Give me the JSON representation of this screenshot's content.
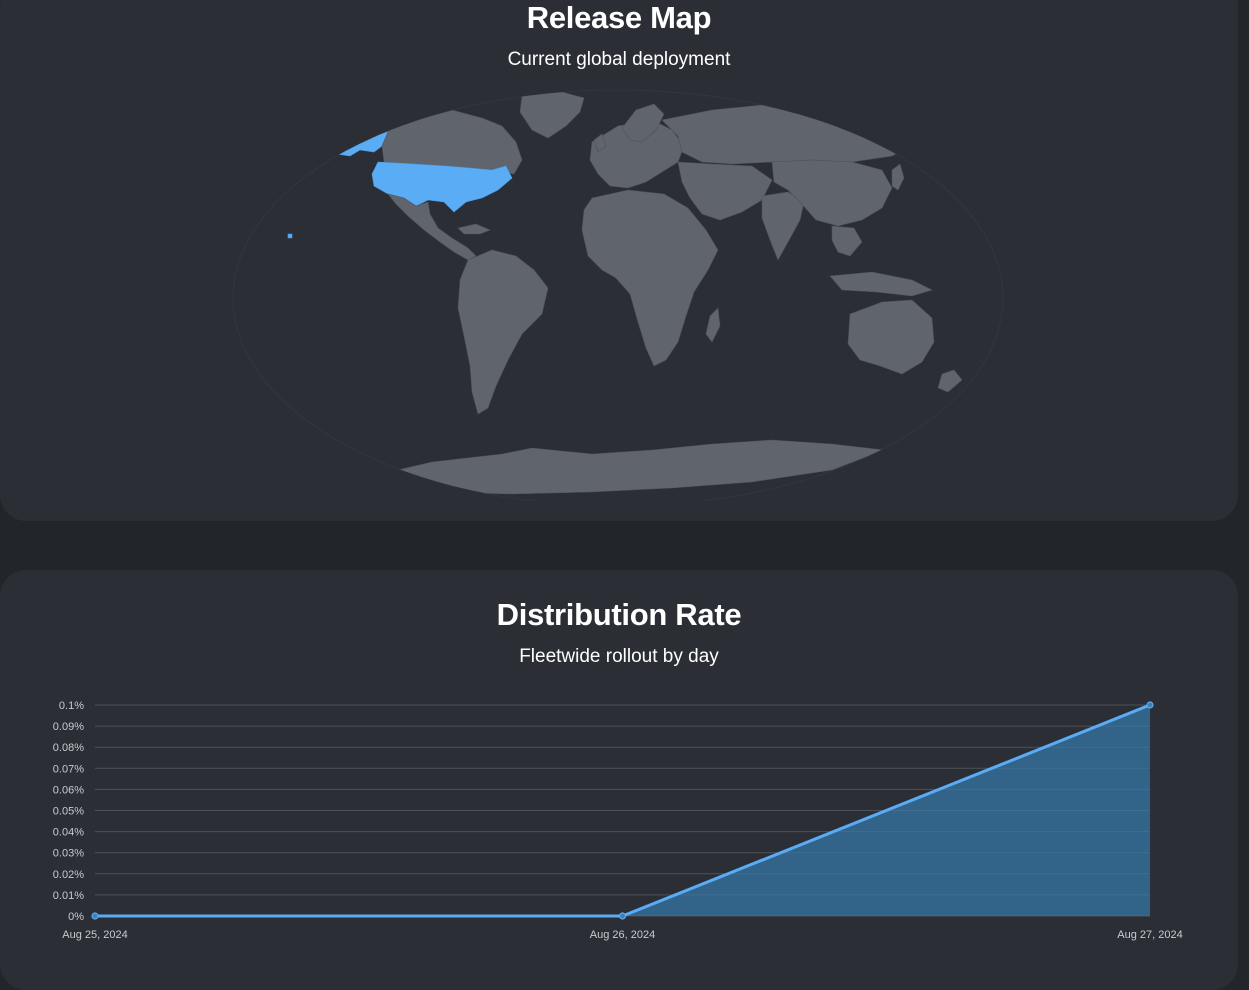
{
  "release_map": {
    "title": "Release Map",
    "subtitle": "Current global deployment",
    "highlighted_regions": [
      "United States"
    ],
    "colors": {
      "land": "#5f646d",
      "highlight": "#5aacf5",
      "background": "#2b2e35"
    }
  },
  "distribution_rate": {
    "title": "Distribution Rate",
    "subtitle": "Fleetwide rollout by day"
  },
  "chart_data": {
    "type": "area",
    "categories": [
      "Aug 25, 2024",
      "Aug 26, 2024",
      "Aug 27, 2024"
    ],
    "values": [
      0,
      0,
      0.1
    ],
    "y_ticks": [
      "0%",
      "0.01%",
      "0.02%",
      "0.03%",
      "0.04%",
      "0.05%",
      "0.06%",
      "0.07%",
      "0.08%",
      "0.09%",
      "0.1%"
    ],
    "ylim": [
      0,
      0.1
    ],
    "grid": true,
    "line_color": "#5aacf5",
    "fill_color": "#33678f"
  }
}
